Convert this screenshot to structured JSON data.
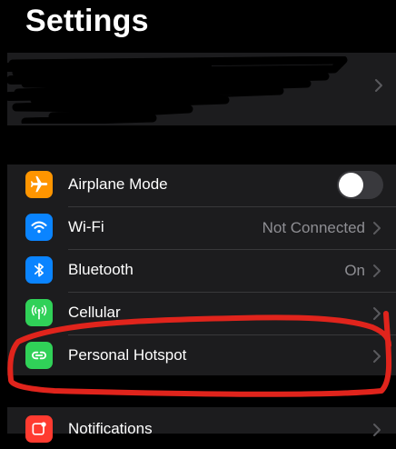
{
  "header": {
    "title": "Settings"
  },
  "groups": [
    {
      "rows": [
        {
          "icon": "airplane-icon",
          "label": "Airplane Mode",
          "toggle": false,
          "color": "#ff9500"
        },
        {
          "icon": "wifi-icon",
          "label": "Wi-Fi",
          "value": "Not Connected",
          "color": "#0a84ff"
        },
        {
          "icon": "bluetooth-icon",
          "label": "Bluetooth",
          "value": "On",
          "color": "#0a84ff"
        },
        {
          "icon": "cellular-icon",
          "label": "Cellular",
          "color": "#30d158"
        },
        {
          "icon": "personal-hotspot-icon",
          "label": "Personal Hotspot",
          "color": "#30d158"
        }
      ]
    },
    {
      "rows": [
        {
          "icon": "notifications-icon",
          "label": "Notifications",
          "color": "#ff3b30"
        }
      ]
    }
  ]
}
